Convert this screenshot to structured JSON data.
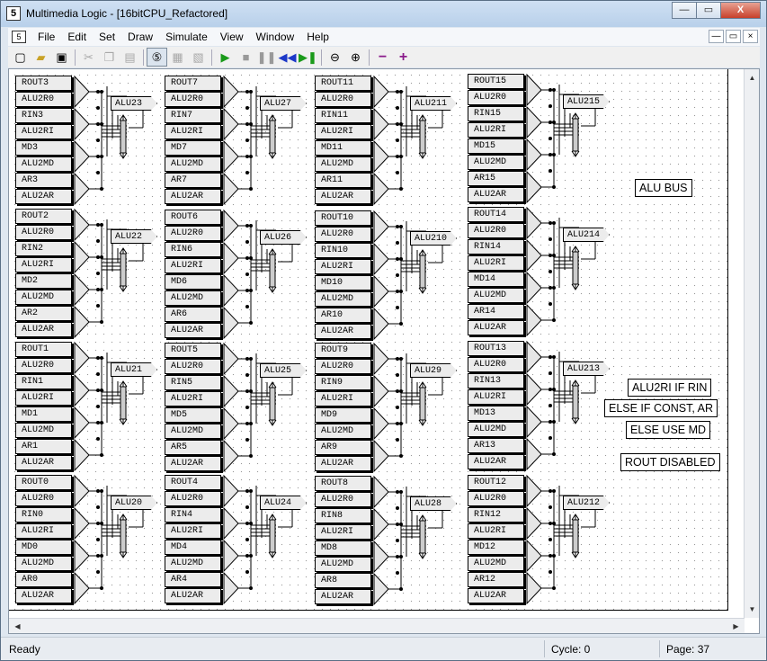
{
  "window": {
    "title": "Multimedia Logic - [16bitCPU_Refactored]",
    "app_icon": "5",
    "caption_buttons": [
      "—",
      "▭",
      "X"
    ]
  },
  "menubar": {
    "items": [
      "File",
      "Edit",
      "Set",
      "Draw",
      "Simulate",
      "View",
      "Window",
      "Help"
    ],
    "mdi_buttons": [
      "—",
      "▭",
      "×"
    ]
  },
  "toolbar": {
    "icons": [
      "new-file-icon",
      "open-folder-icon",
      "save-icon",
      "cut-icon",
      "copy-icon",
      "paste-icon",
      "logic-mode-icon",
      "draw-mode-icon",
      "run-icon",
      "stop-icon",
      "pause-icon",
      "step-back-icon",
      "step-forward-icon",
      "zoom-out-icon",
      "zoom-in-icon",
      "minus-icon",
      "plus-icon"
    ]
  },
  "schematic": {
    "columns": [
      {
        "blocks": [
          {
            "labels": [
              "ROUT3",
              "ALU2R0",
              "RIN3",
              "ALU2RI",
              "MD3",
              "ALU2MD",
              "AR3",
              "ALU2AR"
            ],
            "bus": "ALU23"
          },
          {
            "labels": [
              "ROUT2",
              "ALU2R0",
              "RIN2",
              "ALU2RI",
              "MD2",
              "ALU2MD",
              "AR2",
              "ALU2AR"
            ],
            "bus": "ALU22"
          },
          {
            "labels": [
              "ROUT1",
              "ALU2R0",
              "RIN1",
              "ALU2RI",
              "MD1",
              "ALU2MD",
              "AR1",
              "ALU2AR"
            ],
            "bus": "ALU21"
          },
          {
            "labels": [
              "ROUT0",
              "ALU2R0",
              "RIN0",
              "ALU2RI",
              "MD0",
              "ALU2MD",
              "AR0",
              "ALU2AR"
            ],
            "bus": "ALU20"
          }
        ]
      },
      {
        "blocks": [
          {
            "labels": [
              "ROUT7",
              "ALU2R0",
              "RIN7",
              "ALU2RI",
              "MD7",
              "ALU2MD",
              "AR7",
              "ALU2AR"
            ],
            "bus": "ALU27"
          },
          {
            "labels": [
              "ROUT6",
              "ALU2R0",
              "RIN6",
              "ALU2RI",
              "MD6",
              "ALU2MD",
              "AR6",
              "ALU2AR"
            ],
            "bus": "ALU26"
          },
          {
            "labels": [
              "ROUT5",
              "ALU2R0",
              "RIN5",
              "ALU2RI",
              "MD5",
              "ALU2MD",
              "AR5",
              "ALU2AR"
            ],
            "bus": "ALU25"
          },
          {
            "labels": [
              "ROUT4",
              "ALU2R0",
              "RIN4",
              "ALU2RI",
              "MD4",
              "ALU2MD",
              "AR4",
              "ALU2AR"
            ],
            "bus": "ALU24"
          }
        ]
      },
      {
        "blocks": [
          {
            "labels": [
              "ROUT11",
              "ALU2R0",
              "RIN11",
              "ALU2RI",
              "MD11",
              "ALU2MD",
              "AR11",
              "ALU2AR"
            ],
            "bus": "ALU211"
          },
          {
            "labels": [
              "ROUT10",
              "ALU2R0",
              "RIN10",
              "ALU2RI",
              "MD10",
              "ALU2MD",
              "AR10",
              "ALU2AR"
            ],
            "bus": "ALU210"
          },
          {
            "labels": [
              "ROUT9",
              "ALU2R0",
              "RIN9",
              "ALU2RI",
              "MD9",
              "ALU2MD",
              "AR9",
              "ALU2AR"
            ],
            "bus": "ALU29"
          },
          {
            "labels": [
              "ROUT8",
              "ALU2R0",
              "RIN8",
              "ALU2RI",
              "MD8",
              "ALU2MD",
              "AR8",
              "ALU2AR"
            ],
            "bus": "ALU28"
          }
        ]
      },
      {
        "blocks": [
          {
            "labels": [
              "ROUT15",
              "ALU2R0",
              "RIN15",
              "ALU2RI",
              "MD15",
              "ALU2MD",
              "AR15",
              "ALU2AR"
            ],
            "bus": "ALU215"
          },
          {
            "labels": [
              "ROUT14",
              "ALU2R0",
              "RIN14",
              "ALU2RI",
              "MD14",
              "ALU2MD",
              "AR14",
              "ALU2AR"
            ],
            "bus": "ALU214"
          },
          {
            "labels": [
              "ROUT13",
              "ALU2R0",
              "RIN13",
              "ALU2RI",
              "MD13",
              "ALU2MD",
              "AR13",
              "ALU2AR"
            ],
            "bus": "ALU213"
          },
          {
            "labels": [
              "ROUT12",
              "ALU2R0",
              "RIN12",
              "ALU2RI",
              "MD12",
              "ALU2MD",
              "AR12",
              "ALU2AR"
            ],
            "bus": "ALU212"
          }
        ]
      }
    ],
    "notes": {
      "alu_bus": "ALU BUS",
      "line1": "ALU2RI IF RIN",
      "line2": "ELSE IF CONST, AR",
      "line3": "ELSE USE MD",
      "rout": "ROUT DISABLED"
    }
  },
  "statusbar": {
    "ready": "Ready",
    "cycle": "Cycle: 0",
    "page": "Page: 37"
  }
}
